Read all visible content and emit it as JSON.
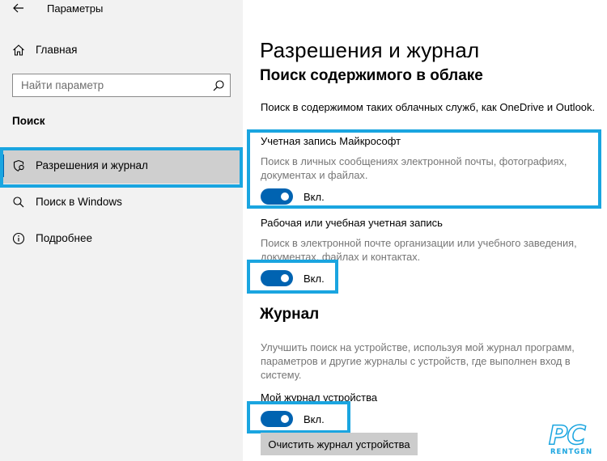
{
  "window": {
    "title": "Параметры"
  },
  "sidebar": {
    "home_label": "Главная",
    "search_placeholder": "Найти параметр",
    "section_label": "Поиск",
    "items": [
      {
        "label": "Разрешения и журнал",
        "active": true,
        "icon": "shield-search-icon"
      },
      {
        "label": "Поиск в Windows",
        "active": false,
        "icon": "search-icon"
      },
      {
        "label": "Подробнее",
        "active": false,
        "icon": "info-icon"
      }
    ]
  },
  "main": {
    "title": "Разрешения и журнал",
    "cloud": {
      "title": "Поиск содержимого в облаке",
      "intro": "Поиск в содержимом таких облачных служб, как OneDrive и Outlook.",
      "ms_account": {
        "title": "Учетная запись Майкрософт",
        "desc_line1": "Поиск в личных сообщениях электронной почты, фотографиях,",
        "desc_line2": "документах и файлах.",
        "state": "Вкл.",
        "on": true
      },
      "work_account": {
        "title": "Рабочая или учебная учетная запись",
        "desc_line1": "Поиск в электронной почте организации или учебного заведения,",
        "desc_line2": "документах, файлах и контактах.",
        "state": "Вкл.",
        "on": true
      }
    },
    "journal": {
      "title": "Журнал",
      "desc_line1": "Улучшить поиск на устройстве, используя мой журнал программ,",
      "desc_line2": "параметров и другие журналы с устройств, где выполнен вход в",
      "desc_line3": "систему.",
      "device_title": "Мой журнал устройства",
      "state": "Вкл.",
      "on": true,
      "clear_button": "Очистить журнал устройства"
    }
  },
  "colors": {
    "accent": "#0063b1",
    "highlight": "#1aa5e0",
    "sidebar_bg": "#f2f2f2"
  },
  "watermark": {
    "main": "PC",
    "sub": "RENTGEN"
  }
}
